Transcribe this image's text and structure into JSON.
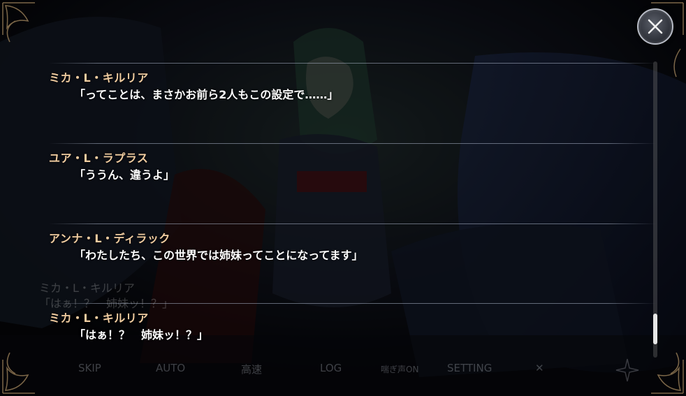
{
  "log": {
    "entries": [
      {
        "speaker": "ミカ・L・キルリア",
        "text": "「ってことは、まさかお前ら2人もこの設定で……」"
      },
      {
        "speaker": "ユア・L・ラプラス",
        "text": "「ううん、違うよ」"
      },
      {
        "speaker": "アンナ・L・ディラック",
        "text": "「わたしたち、この世界では姉妹ってことになってます」"
      },
      {
        "speaker": "ミカ・L・キルリア",
        "text": "「はぁ！？　姉妹ッ！？」"
      }
    ]
  },
  "background_dialogue": {
    "speaker": "ミカ・L・キルリア",
    "text": "「はぁ！？　姉妹ッ！？」"
  },
  "menu": {
    "skip": "SKIP",
    "auto": "AUTO",
    "fast": "高速",
    "log": "LOG",
    "voice": "喘ぎ声ON",
    "setting": "SETTING",
    "close": "✕"
  },
  "scroll": {
    "position_fraction": 0.95
  },
  "icons": {
    "close": "close-icon",
    "bottom_ornament": "ornament-icon"
  },
  "colors": {
    "speaker_name": "#f0cca0",
    "dialogue_text": "#ffffff",
    "frame_gold": "#8a7250"
  }
}
